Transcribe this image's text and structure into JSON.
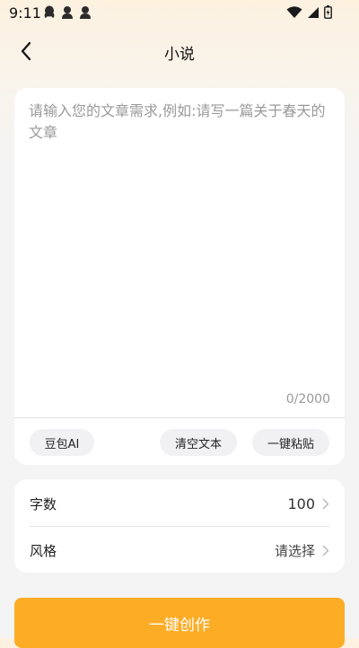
{
  "status_bar": {
    "time": "9:11",
    "notification_icons": [
      "qq-icon",
      "person-icon",
      "person-icon"
    ],
    "system_icons": [
      "wifi-icon",
      "signal-icon",
      "battery-icon"
    ]
  },
  "header": {
    "title": "小说",
    "back_icon": "chevron-left-icon"
  },
  "editor": {
    "placeholder": "请输入您的文章需求,例如:请写一篇关于春天的文章",
    "value": "",
    "counter": "0/2000",
    "actions": {
      "ai_label": "豆包AI",
      "clear_label": "清空文本",
      "paste_label": "一键粘贴"
    }
  },
  "settings": {
    "word_count": {
      "label": "字数",
      "value": "100"
    },
    "style": {
      "label": "风格",
      "placeholder": "请选择"
    }
  },
  "create_button": {
    "label": "一键创作"
  },
  "colors": {
    "accent": "#fdac25",
    "card": "#ffffff",
    "background": "#f4f4f5",
    "header_tint": "#fdf1e0"
  }
}
